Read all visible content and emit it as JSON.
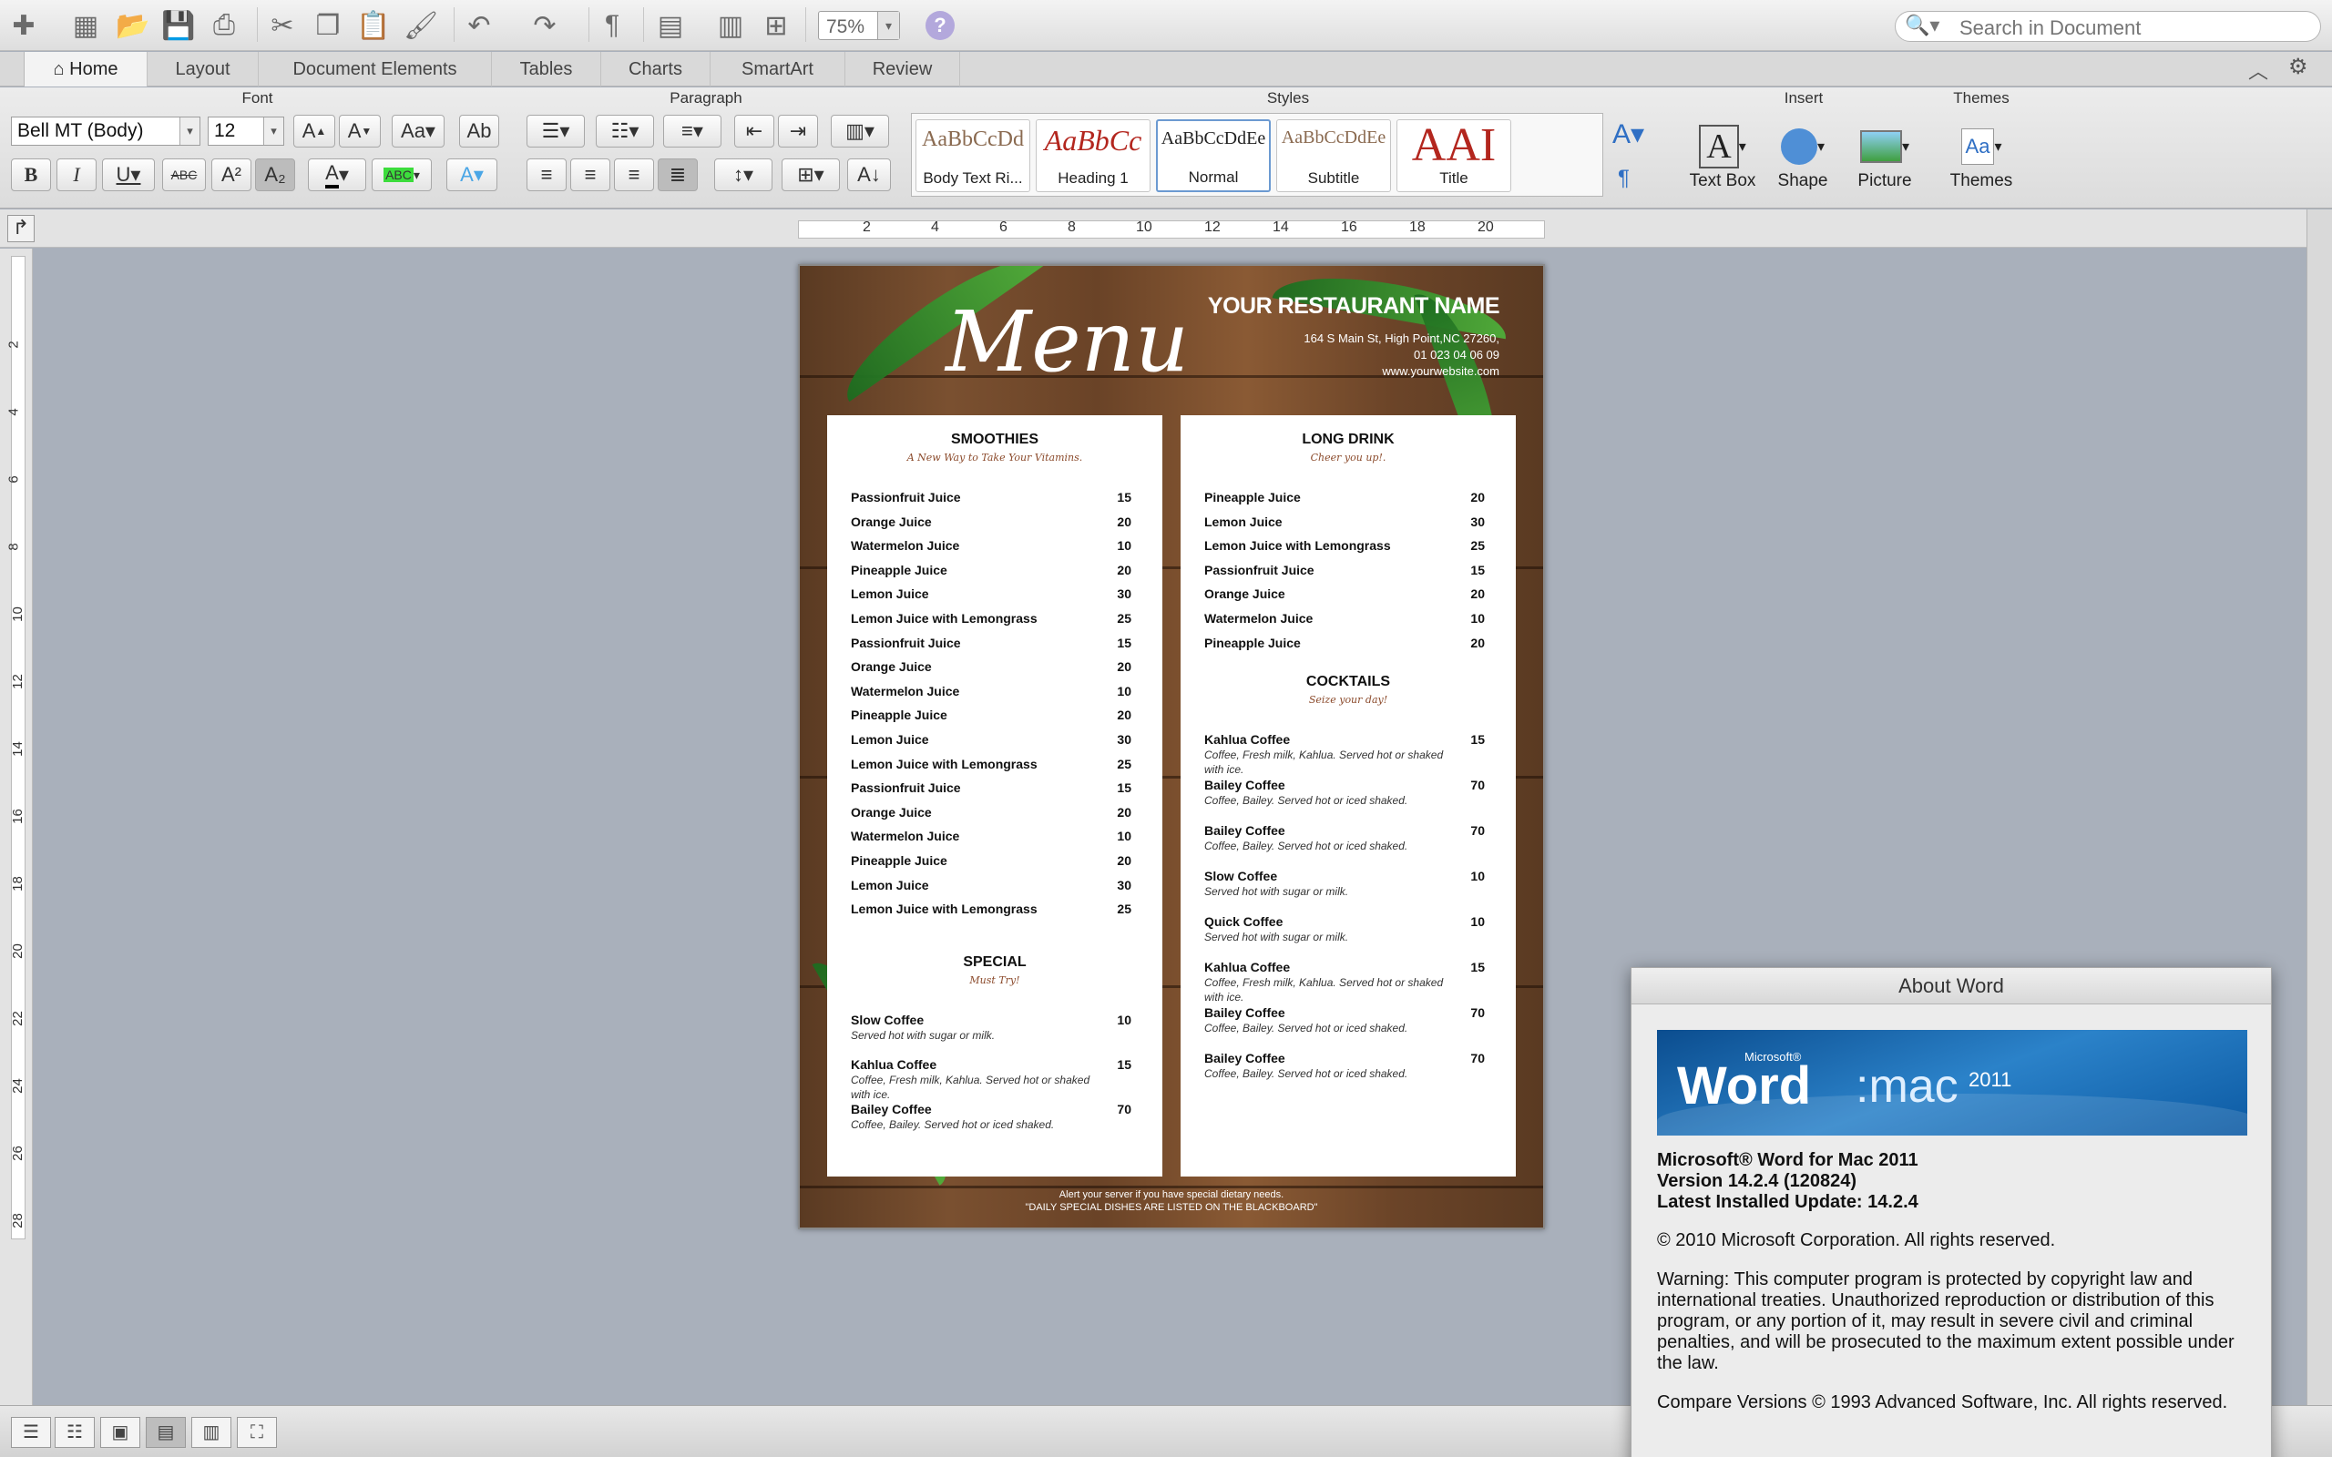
{
  "toolbar": {
    "zoom": "75%",
    "search_placeholder": "Search in Document",
    "help": "?"
  },
  "tabs": [
    "Home",
    "Layout",
    "Document Elements",
    "Tables",
    "Charts",
    "SmartArt",
    "Review"
  ],
  "ribbon": {
    "font_group": "Font",
    "paragraph_group": "Paragraph",
    "styles_group": "Styles",
    "insert_group": "Insert",
    "themes_group": "Themes",
    "font_name": "Bell MT (Body)",
    "font_size": "12",
    "styles": [
      {
        "preview": "AaBbCcDd",
        "name": "Body Text Ri..."
      },
      {
        "preview": "AaBbCc",
        "name": "Heading 1"
      },
      {
        "preview": "AaBbCcDdEe",
        "name": "Normal"
      },
      {
        "preview": "AaBbCcDdEe",
        "name": "Subtitle"
      },
      {
        "preview": "AAI",
        "name": "Title"
      }
    ],
    "insert": [
      "Text Box",
      "Shape",
      "Picture"
    ],
    "themes": "Themes"
  },
  "ruler": {
    "h_numbers": [
      "2",
      "4",
      "6",
      "8",
      "10",
      "12",
      "14",
      "16",
      "18",
      "20"
    ],
    "v_numbers": [
      "2",
      "4",
      "6",
      "8",
      "10",
      "12",
      "14",
      "16",
      "18",
      "20",
      "22",
      "24",
      "26",
      "28"
    ]
  },
  "document": {
    "menu_title": "Menu",
    "restaurant_name": "YOUR RESTAURANT NAME",
    "address": "164 S Main St, High Point,NC 27260,",
    "phone": "01 023 04 06 09",
    "website": "www.yourwebsite.com",
    "smoothies": {
      "title": "SMOOTHIES",
      "subtitle": "A New Way to Take Your Vitamins.",
      "items": [
        {
          "name": "Passionfruit Juice",
          "price": "15"
        },
        {
          "name": "Orange Juice",
          "price": "20"
        },
        {
          "name": "Watermelon Juice",
          "price": "10"
        },
        {
          "name": "Pineapple Juice",
          "price": "20"
        },
        {
          "name": "Lemon Juice",
          "price": "30"
        },
        {
          "name": "Lemon Juice with Lemongrass",
          "price": "25"
        },
        {
          "name": "Passionfruit Juice",
          "price": "15"
        },
        {
          "name": "Orange Juice",
          "price": "20"
        },
        {
          "name": "Watermelon Juice",
          "price": "10"
        },
        {
          "name": "Pineapple Juice",
          "price": "20"
        },
        {
          "name": "Lemon Juice",
          "price": "30"
        },
        {
          "name": "Lemon Juice with Lemongrass",
          "price": "25"
        },
        {
          "name": "Passionfruit Juice",
          "price": "15"
        },
        {
          "name": "Orange Juice",
          "price": "20"
        },
        {
          "name": "Watermelon Juice",
          "price": "10"
        },
        {
          "name": "Pineapple Juice",
          "price": "20"
        },
        {
          "name": "Lemon Juice",
          "price": "30"
        },
        {
          "name": "Lemon Juice with Lemongrass",
          "price": "25"
        }
      ]
    },
    "special": {
      "title": "SPECIAL",
      "subtitle": "Must Try!",
      "items": [
        {
          "name": "Slow Coffee",
          "price": "10",
          "desc": "Served hot with sugar or milk."
        },
        {
          "name": "Kahlua Coffee",
          "price": "15",
          "desc": "Coffee, Fresh milk, Kahlua. Served hot or shaked with ice."
        },
        {
          "name": "Bailey Coffee",
          "price": "70",
          "desc": "Coffee, Bailey. Served hot or iced shaked."
        }
      ]
    },
    "long_drink": {
      "title": "LONG DRINK",
      "subtitle": "Cheer you up!.",
      "items": [
        {
          "name": "Pineapple Juice",
          "price": "20"
        },
        {
          "name": "Lemon Juice",
          "price": "30"
        },
        {
          "name": "Lemon Juice with Lemongrass",
          "price": "25"
        },
        {
          "name": "Passionfruit Juice",
          "price": "15"
        },
        {
          "name": "Orange Juice",
          "price": "20"
        },
        {
          "name": "Watermelon Juice",
          "price": "10"
        },
        {
          "name": "Pineapple Juice",
          "price": "20"
        }
      ]
    },
    "cocktails": {
      "title": "COCKTAILS",
      "subtitle": "Seize your day!",
      "items": [
        {
          "name": "Kahlua Coffee",
          "price": "15",
          "desc": "Coffee, Fresh milk, Kahlua. Served hot or shaked with ice."
        },
        {
          "name": "Bailey Coffee",
          "price": "70",
          "desc": "Coffee, Bailey. Served hot or iced shaked."
        },
        {
          "name": "Bailey Coffee",
          "price": "70",
          "desc": "Coffee, Bailey. Served hot or iced shaked."
        },
        {
          "name": "Slow Coffee",
          "price": "10",
          "desc": "Served hot with sugar or milk."
        },
        {
          "name": "Quick Coffee",
          "price": "10",
          "desc": "Served hot with sugar or milk."
        },
        {
          "name": "Kahlua Coffee",
          "price": "15",
          "desc": "Coffee, Fresh milk, Kahlua. Served hot or shaked with ice."
        },
        {
          "name": "Bailey Coffee",
          "price": "70",
          "desc": "Coffee, Bailey. Served hot or iced shaked."
        },
        {
          "name": "Bailey Coffee",
          "price": "70",
          "desc": "Coffee, Bailey. Served hot or iced shaked."
        }
      ]
    },
    "footer_line1": "Alert your server if you have special dietary needs.",
    "footer_line2": "\"DAILY SPECIAL DISHES ARE LISTED ON THE BLACKBOARD\""
  },
  "about": {
    "title": "About Word",
    "banner_word": "Word",
    "banner_mac": ":mac",
    "banner_ms": "Microsoft®",
    "banner_year": "2011",
    "product": "Microsoft® Word for Mac 2011",
    "version": "Version 14.2.4 (120824)",
    "update": "Latest Installed Update: 14.2.4",
    "copyright": "© 2010 Microsoft Corporation. All rights reserved.",
    "warning": "Warning: This computer program is protected by copyright law and international treaties.  Unauthorized reproduction or distribution of this program, or any portion of it, may result in severe civil and criminal penalties, and will be prosecuted to the maximum extent possible under the law.",
    "compare": "Compare Versions © 1993 Advanced Software, Inc.  All rights reserved."
  }
}
